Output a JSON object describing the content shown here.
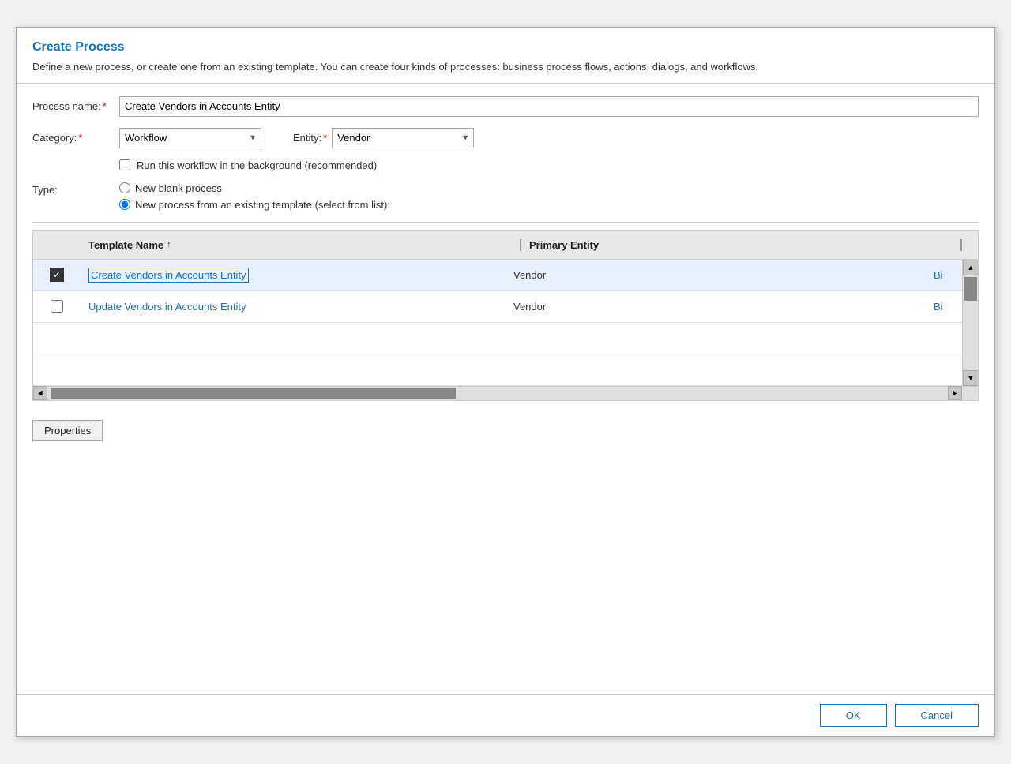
{
  "dialog": {
    "title": "Create Process",
    "description": "Define a new process, or create one from an existing template. You can create four kinds of processes: business process flows, actions, dialogs, and workflows."
  },
  "form": {
    "process_name_label": "Process name:",
    "process_name_value": "Create Vendors in Accounts Entity",
    "category_label": "Category:",
    "category_value": "Workflow",
    "entity_label": "Entity:",
    "entity_value": "Vendor",
    "checkbox_label": "Run this workflow in the background (recommended)",
    "type_label": "Type:",
    "radio_blank": "New blank process",
    "radio_template": "New process from an existing template (select from list):"
  },
  "table": {
    "col_template_name": "Template Name",
    "col_primary_entity": "Primary Entity",
    "sort_indicator": "↑",
    "rows": [
      {
        "selected": true,
        "name": "Create Vendors in Accounts Entity",
        "entity": "Vendor",
        "extra": "Bi"
      },
      {
        "selected": false,
        "name": "Update Vendors in Accounts Entity",
        "entity": "Vendor",
        "extra": "Bi"
      }
    ]
  },
  "buttons": {
    "properties": "Properties",
    "ok": "OK",
    "cancel": "Cancel"
  }
}
